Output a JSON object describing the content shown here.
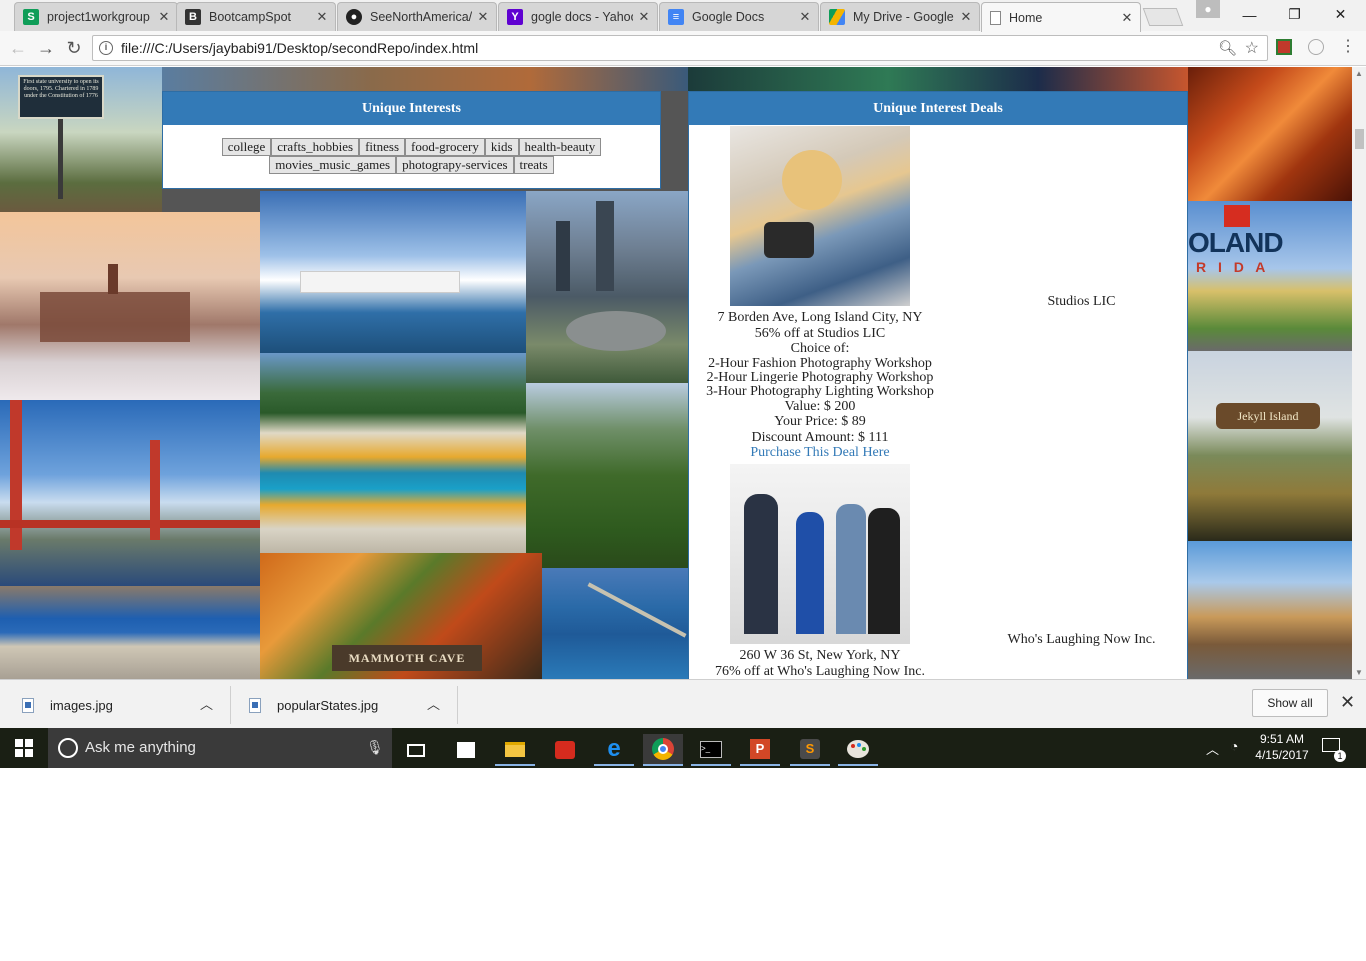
{
  "browser": {
    "tabs": [
      {
        "title": "project1workgroup",
        "icon": "sheets-favicon",
        "active": false
      },
      {
        "title": "BootcampSpot",
        "icon": "bootcamp-favicon",
        "active": false
      },
      {
        "title": "SeeNorthAmerica/",
        "icon": "github-favicon",
        "active": false
      },
      {
        "title": "gogle docs - Yahoo",
        "icon": "yahoo-favicon",
        "active": false
      },
      {
        "title": "Google Docs",
        "icon": "docs-favicon",
        "active": false
      },
      {
        "title": "My Drive - Google",
        "icon": "drive-favicon",
        "active": false
      },
      {
        "title": "Home",
        "icon": "page-favicon",
        "active": true
      }
    ],
    "url": "file:///C:/Users/jaybabi91/Desktop/secondRepo/index.html"
  },
  "page": {
    "interests": {
      "heading": "Unique Interests",
      "buttons": [
        "college",
        "crafts_hobbies",
        "fitness",
        "food-grocery",
        "kids",
        "health-beauty",
        "movies_music_games",
        "photograpy-services",
        "treats"
      ]
    },
    "deals": {
      "heading": "Unique Interest Deals",
      "items": [
        {
          "address": "7 Borden Ave, Long Island City, NY",
          "headline": "56% off at Studios LIC",
          "choice_label": "Choice of:",
          "options": [
            "2-Hour Fashion Photography Workshop",
            "2-Hour Lingerie Photography Workshop",
            "3-Hour Photography Lighting Workshop"
          ],
          "value": "Value: $ 200",
          "price": "Your Price: $ 89",
          "discount": "Discount Amount: $ 111",
          "link": "Purchase This Deal Here",
          "merchant": "Studios LIC"
        },
        {
          "address": "260 W 36 St, New York, NY",
          "headline": "76% off at Who's Laughing Now Inc.",
          "merchant": "Who's Laughing Now Inc."
        }
      ]
    },
    "background_photos": [
      "bridge-sign",
      "canyon-rock",
      "snowy-campus",
      "memorial-harbor",
      "city-stadium",
      "legoland",
      "hot-spring",
      "river-gorge",
      "golden-gate-bridge",
      "jekyll-island",
      "hoover-dam",
      "autumn-cave",
      "coast-causeway",
      "palm-street"
    ],
    "background_texts": {
      "sign_text": "First state university to open its doors, 1795. Chartered in 1789 under the Constitution of 1776",
      "legoland_top": "OLAND",
      "legoland_bottom": "R I D A",
      "jekyll_sign": "Jekyll Island",
      "cave_sign": "MAMMOTH CAVE"
    }
  },
  "downloads": {
    "items": [
      "images.jpg",
      "popularStates.jpg"
    ],
    "show_all": "Show all"
  },
  "taskbar": {
    "search_placeholder": "Ask me anything",
    "time": "9:51 AM",
    "date": "4/15/2017",
    "notification_count": "1"
  }
}
